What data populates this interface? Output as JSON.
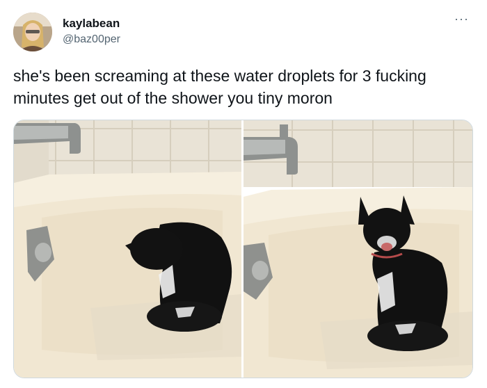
{
  "tweet": {
    "display_name": "kaylabean",
    "handle": "@baz00per",
    "more_label": "···",
    "text": "she's been screaming at these water droplets for 3 fucking minutes get out of the shower you tiny moron"
  },
  "media": {
    "photo_count": 2,
    "photos": [
      {
        "subject": "black cat in bathtub looking down"
      },
      {
        "subject": "black cat in bathtub meowing"
      }
    ]
  },
  "colors": {
    "text": "#0f1419",
    "secondary": "#536471",
    "border": "#cfd9de",
    "tile": "#e9e3d6",
    "tub": "#f3ecdc",
    "cat": "#111111"
  }
}
